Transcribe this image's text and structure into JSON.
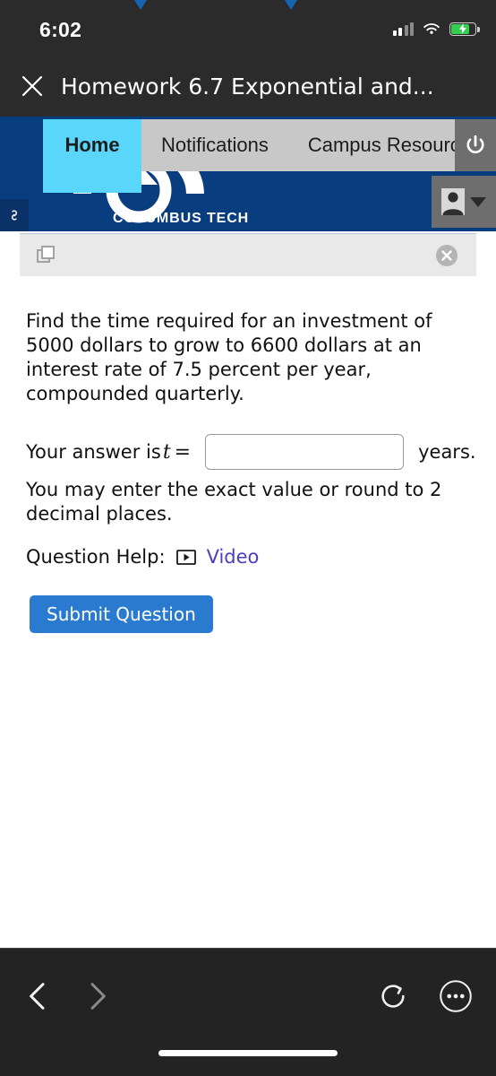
{
  "status_bar": {
    "time": "6:02",
    "signal_icon": "cellular-signal-icon",
    "wifi_icon": "wifi-icon",
    "battery_icon": "battery-charging-icon"
  },
  "browser_title_bar": {
    "close_icon": "close-icon",
    "title": "Homework 6.7 Exponential and..."
  },
  "site_header": {
    "logo_text": "COLUMBUS TECH",
    "logo_icon": "ctc-circle-logo-icon",
    "link_icon": "chain-link-icon",
    "background_color": "#083d80",
    "tabs": [
      {
        "label": "Home",
        "active": true
      },
      {
        "label": "Notifications",
        "active": false
      },
      {
        "label": "Campus Resource",
        "active": false
      }
    ],
    "active_tab_color": "#5ad6fb",
    "power_icon": "power-icon",
    "avatar_icon": "user-avatar-icon",
    "avatar_caret_icon": "chevron-down-icon"
  },
  "utility_strip": {
    "stack_icon": "windows-stack-icon",
    "close_icon": "close-circle-icon"
  },
  "question": {
    "prompt": "Find the time required for an investment of 5000 dollars to grow to 6600 dollars at an interest rate of 7.5 percent per year, compounded quarterly.",
    "answer_prefix": "Your answer is",
    "answer_variable": "t",
    "answer_equals": "=",
    "answer_value": "",
    "answer_placeholder": "",
    "answer_units": "years.",
    "hint": "You may enter the exact value or round to 2 decimal places.",
    "help_label": "Question Help:",
    "help_video_icon": "video-play-icon",
    "help_video_link": "Video",
    "help_link_color": "#4b3fbf",
    "submit_label": "Submit Question",
    "submit_color": "#2a7ad0"
  },
  "bottom_bar": {
    "back_icon": "chevron-left-icon",
    "forward_icon": "chevron-right-icon",
    "reload_icon": "reload-icon",
    "more_icon": "more-options-icon",
    "home_indicator": "home-indicator"
  }
}
